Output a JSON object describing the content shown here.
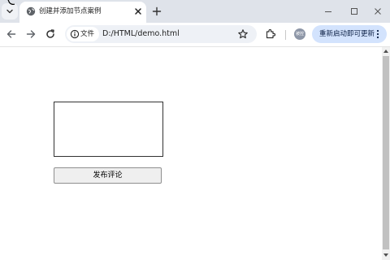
{
  "tab": {
    "title": "创建并添加节点案例",
    "favicon": "globe-icon"
  },
  "window_controls": [
    "minimize-icon",
    "maximize-icon",
    "close-icon"
  ],
  "toolbar": {
    "site_chip_label": "文件",
    "url": "D:/HTML/demo.html",
    "avatar_text": "被控",
    "relaunch_label": "重新启动即可更新"
  },
  "page": {
    "comment_value": "",
    "publish_label": "发布评论"
  },
  "colors": {
    "tabstrip": "#dfe3ea",
    "omnibox": "#eef1f6",
    "relaunch": "#d3e3fd",
    "button": "#efefef"
  }
}
